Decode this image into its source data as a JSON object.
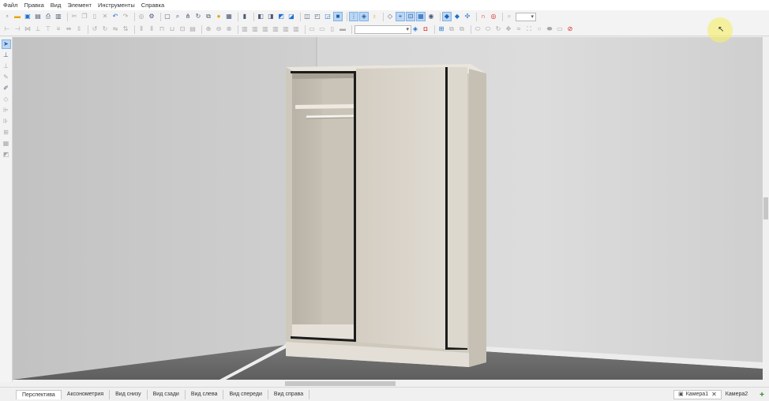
{
  "menu": [
    "Файл",
    "Правка",
    "Вид",
    "Элемент",
    "Инструменты",
    "Справка"
  ],
  "toolbar1": {
    "group1": [
      "new-icon",
      "open-folder-icon",
      "save-icon",
      "save-as-icon",
      "print-icon",
      "print-preview-icon"
    ],
    "group2": [
      "cut-icon",
      "copy-icon",
      "paste-icon",
      "delete-icon",
      "undo-icon",
      "redo-icon"
    ],
    "group3": [
      "properties-icon",
      "settings-icon",
      "zoom-fit-icon",
      "zoom-icon",
      "share-icon",
      "rotate-icon",
      "copy-object-icon",
      "sun-icon"
    ],
    "group4": [
      "book-icon",
      "cube-front-icon",
      "cube-top-icon",
      "cube-side-icon",
      "cube-iso-icon",
      "cube-back-icon",
      "cube-left-icon",
      "cube-shaded-icon"
    ],
    "group5": [
      "grid-icon",
      "snap-icon",
      "light-bulb-icon"
    ],
    "group6": [
      "tag-icon",
      "measure-icon",
      "dimension-icon",
      "table-icon",
      "eye-icon"
    ],
    "group7": [
      "node-point-icon",
      "node-line-icon",
      "node-move-icon",
      "magnet-icon",
      "target-icon"
    ],
    "zoom_search_icon": "search-icon"
  },
  "toolbar2": {
    "combo_value": ""
  },
  "left_toolbar": [
    "select-arrow-icon",
    "dimension-tool-icon",
    "ruler-tool-icon",
    "pen-tool-icon",
    "eyedropper-icon",
    "shape-tool-icon",
    "align-left-icon",
    "align-icon",
    "stack-icon",
    "layers-icon",
    "extrude-icon"
  ],
  "view_tabs": [
    {
      "label": "Перспектива",
      "active": true
    },
    {
      "label": "Аксонометрия",
      "active": false
    },
    {
      "label": "Вид снизу",
      "active": false
    },
    {
      "label": "Вид сзади",
      "active": false
    },
    {
      "label": "Вид слева",
      "active": false
    },
    {
      "label": "Вид спереди",
      "active": false
    },
    {
      "label": "Вид справа",
      "active": false
    }
  ],
  "camera_tabs": [
    {
      "label": "Камера1",
      "active": true
    },
    {
      "label": "Камера2",
      "active": false
    }
  ],
  "colors": {
    "wall_left": "#cbcbcb",
    "wall_back": "#d4d4d4",
    "floor": "#6a6a6a",
    "cabinet": "#d8d2c6",
    "cabinet_dark": "#1c1c1c",
    "door": "#dcd6cc"
  }
}
